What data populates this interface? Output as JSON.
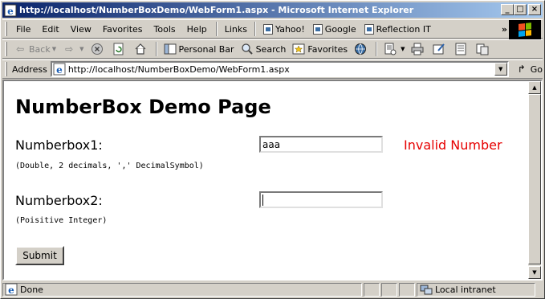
{
  "window": {
    "title": "http://localhost/NumberBoxDemo/WebForm1.aspx - Microsoft Internet Explorer",
    "controls": [
      "_",
      "□",
      "×"
    ]
  },
  "menubar": {
    "items": [
      "File",
      "Edit",
      "View",
      "Favorites",
      "Tools",
      "Help"
    ],
    "links_label": "Links",
    "links": [
      "Yahoo!",
      "Google",
      "Reflection IT"
    ],
    "overflow": "»"
  },
  "toolbar": {
    "back": "Back",
    "personal_bar": "Personal Bar",
    "search": "Search",
    "favorites": "Favorites"
  },
  "addressbar": {
    "label": "Address",
    "url": "http://localhost/NumberBoxDemo/WebForm1.aspx",
    "go": "Go"
  },
  "page": {
    "heading": "NumberBox Demo Page",
    "field1": {
      "label": "Numberbox1:",
      "value": "aaa",
      "hint": "(Double, 2 decimals, ',' DecimalSymbol)",
      "error": "Invalid Number"
    },
    "field2": {
      "label": "Numberbox2:",
      "value": "",
      "hint": "(Poisitive Integer)"
    },
    "submit": "Submit"
  },
  "statusbar": {
    "status": "Done",
    "zone": "Local intranet"
  },
  "colors": {
    "titlebar_start": "#0a246a",
    "titlebar_end": "#a6caf0",
    "error": "#e60000",
    "chrome": "#d4d0c8"
  }
}
